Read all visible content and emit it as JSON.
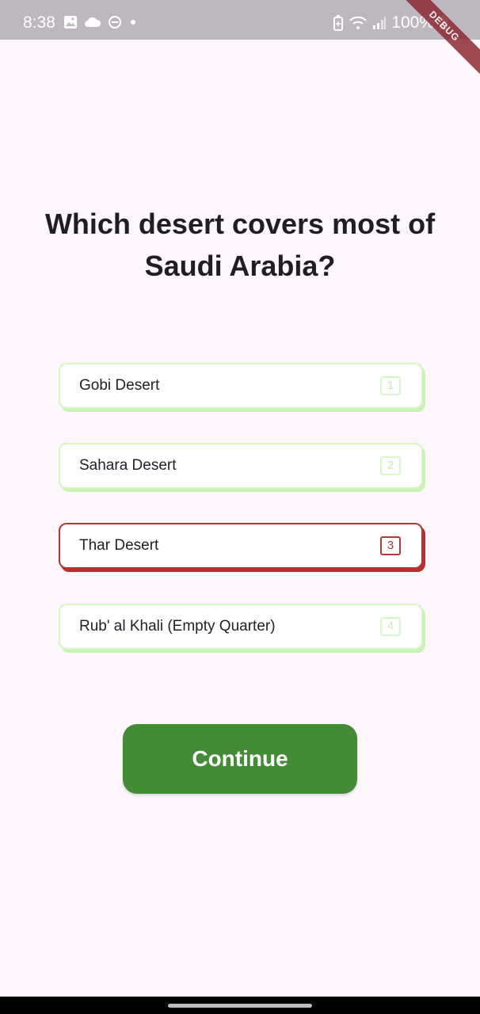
{
  "status_bar": {
    "time": "8:38",
    "battery": "100%",
    "icons_left": [
      "image-icon",
      "cloud-icon",
      "dnd-icon",
      "dot-icon"
    ],
    "icons_right": [
      "battery-saver-icon",
      "wifi-icon",
      "signal-icon",
      "battery-icon"
    ]
  },
  "debug_banner": "DEBUG",
  "question": "Which desert covers most of Saudi Arabia?",
  "options": [
    {
      "label": "Gobi Desert",
      "key": "1",
      "selected": false
    },
    {
      "label": "Sahara Desert",
      "key": "2",
      "selected": false
    },
    {
      "label": "Thar Desert",
      "key": "3",
      "selected": true
    },
    {
      "label": "Rub' al Khali (Empty Quarter)",
      "key": "4",
      "selected": false
    }
  ],
  "continue_label": "Continue",
  "colors": {
    "accent_green": "#438c35",
    "option_border": "#d6f6c3",
    "selected_red": "#bd3235",
    "background": "#fdf7fc"
  }
}
